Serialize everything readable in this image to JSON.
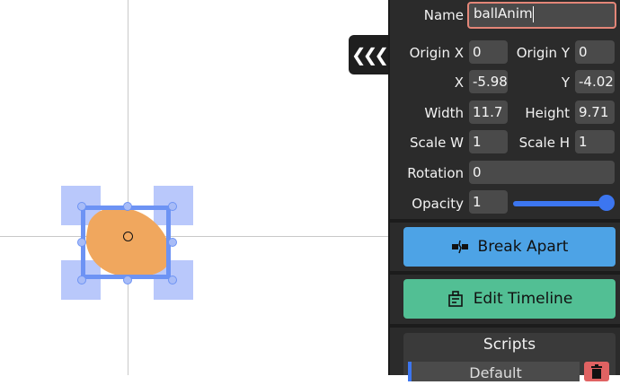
{
  "properties": {
    "name_label": "Name",
    "name_value": "ballAnim",
    "origin_x_label": "Origin X",
    "origin_x_value": "0",
    "origin_y_label": "Origin Y",
    "origin_y_value": "0",
    "x_label": "X",
    "x_value": "-5.98",
    "y_label": "Y",
    "y_value": "-4.02",
    "width_label": "Width",
    "width_value": "11.7",
    "height_label": "Height",
    "height_value": "9.71",
    "scale_w_label": "Scale W",
    "scale_w_value": "1",
    "scale_h_label": "Scale H",
    "scale_h_value": "1",
    "rotation_label": "Rotation",
    "rotation_value": "0",
    "opacity_label": "Opacity",
    "opacity_value": "1",
    "opacity_slider_level": 1.0
  },
  "actions": {
    "break_apart_label": "Break Apart",
    "edit_timeline_label": "Edit Timeline"
  },
  "scripts": {
    "title": "Scripts",
    "items": [
      "Default"
    ]
  },
  "icons": {
    "collapse": "chevrons-left-icon",
    "break_apart": "break-apart-icon",
    "edit_timeline": "timeline-icon",
    "delete": "trash-icon"
  },
  "colors": {
    "panel_bg": "#2b2b2b",
    "field_bg": "#4a4a4a",
    "accent_blue": "#3c76f0",
    "name_border": "#e48678",
    "break_apart_bg": "#4da3e6",
    "edit_timeline_bg": "#52bf94",
    "selection": "#6d93f4",
    "shape_fill": "#f0a75e",
    "delete_bg": "#e06262"
  }
}
